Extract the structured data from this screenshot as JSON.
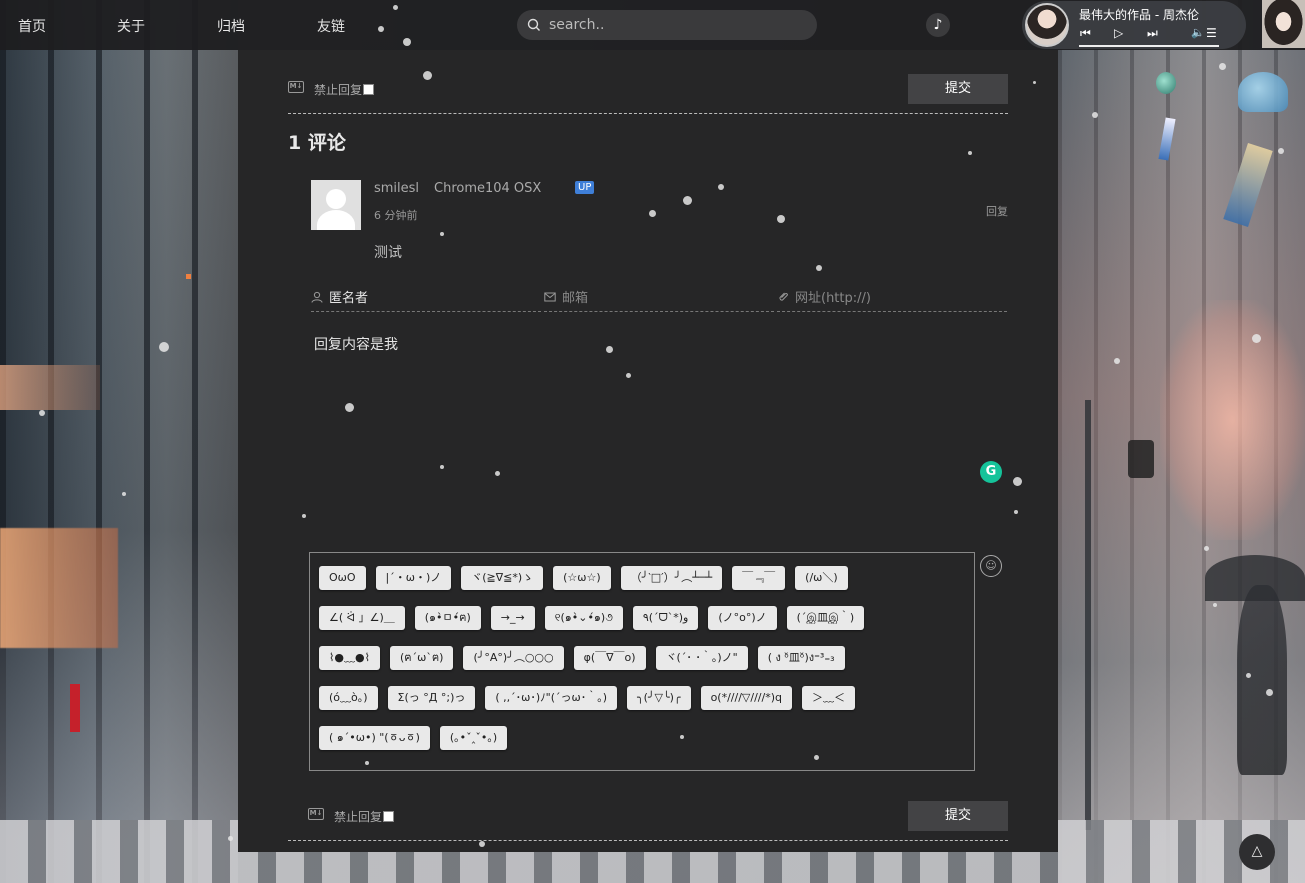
{
  "nav": {
    "items": [
      "首页",
      "关于",
      "归档",
      "友链"
    ]
  },
  "search": {
    "placeholder": "search.."
  },
  "music_toggle": {
    "icon": "♪"
  },
  "player": {
    "song": "最伟大的作品 - 周杰伦",
    "prev": "⏮",
    "play": "▷",
    "next": "⏭",
    "volume": "🔈",
    "list": "☰"
  },
  "form": {
    "md_label": "M↓",
    "no_reply_label": "禁止回复",
    "submit_label": "提交"
  },
  "comments": {
    "count_title": "1 评论",
    "items": [
      {
        "nick": "smilesl",
        "ua": "Chrome104 OSX",
        "badge": "UP",
        "time": "6 分钟前",
        "reply_label": "回复",
        "text": "测试"
      }
    ]
  },
  "fields": {
    "name": "匿名者",
    "email_placeholder": "邮箱",
    "url_placeholder": "网址(http://)"
  },
  "reply": {
    "content": "回复内容是我",
    "grammarly": "G",
    "emoji_toggle_icon": "☺"
  },
  "emoji_rows": [
    [
      "OωO",
      "|´・ω・)ノ",
      "ヾ(≧∇≦*)ゝ",
      "(☆ω☆)",
      "（╯‵□′）╯︵┴─┴",
      "￣﹃￣",
      "(/ω＼)"
    ],
    [
      "∠( ᐛ 」∠)＿",
      "(๑•̀ㅁ•́ฅ)",
      "→_→",
      "୧(๑•̀⌄•́๑)૭",
      "٩(ˊᗜˋ*)و",
      "(ノ°ο°)ノ",
      "(´இ皿இ｀)"
    ],
    [
      "⌇●﹏●⌇",
      "(ฅ´ω`ฅ)",
      "(╯°A°)╯︵○○○",
      "φ(￣∇￣o)",
      "ヾ(´･ ･｀｡)ノ\"",
      "( ง ᵒ̌皿ᵒ̌)ง⁼³₌₃"
    ],
    [
      "(ó﹏ò｡)",
      "Σ(っ °Д °;)っ",
      "( ,,´･ω･)ﾉ\"(´っω･｀｡)",
      "╮(╯▽╰)╭",
      "o(*////▽////*)q",
      "＞﹏＜"
    ],
    [
      "( ๑´•ω•) \"(ㆆᴗㆆ)",
      "(｡•ˇ‸ˇ•｡)"
    ]
  ],
  "back_top": "△",
  "colors": {
    "panel_bg": "#262627",
    "badge": "#3f7fd8",
    "grammarly": "#15c39a"
  }
}
